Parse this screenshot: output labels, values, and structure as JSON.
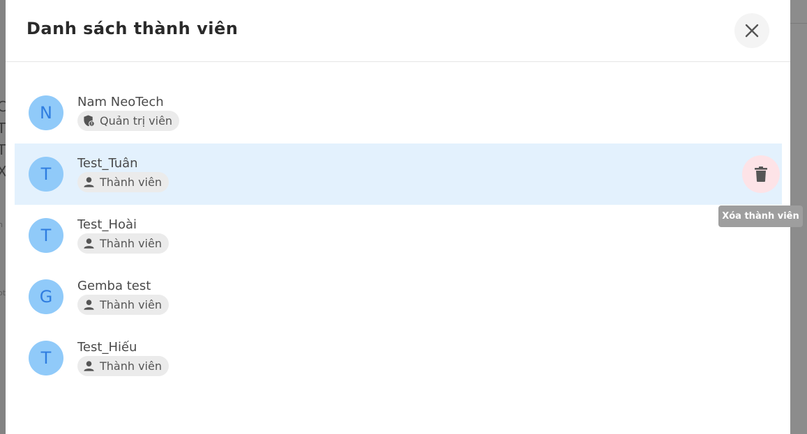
{
  "background": {
    "chars": [
      "C",
      "T",
      "T",
      "X"
    ],
    "fragments": [
      "n",
      "ot"
    ]
  },
  "dialog": {
    "title": "Danh sách thành viên",
    "close_icon": "close-icon"
  },
  "members": [
    {
      "initial": "N",
      "name": "Nam NeoTech",
      "role": "Quản trị viên",
      "role_icon": "admin-shield-icon",
      "highlighted": false
    },
    {
      "initial": "T",
      "name": "Test_Tuân",
      "role": "Thành viên",
      "role_icon": "person-icon",
      "highlighted": true
    },
    {
      "initial": "T",
      "name": "Test_Hoài",
      "role": "Thành viên",
      "role_icon": "person-icon",
      "highlighted": false
    },
    {
      "initial": "G",
      "name": "Gemba test",
      "role": "Thành viên",
      "role_icon": "person-icon",
      "highlighted": false
    },
    {
      "initial": "T",
      "name": "Test_Hiếu",
      "role": "Thành viên",
      "role_icon": "person-icon",
      "highlighted": false
    }
  ],
  "delete_action": {
    "icon": "trash-icon",
    "tooltip": "Xóa thành viên"
  },
  "colors": {
    "avatar_bg": "#90caf9",
    "avatar_text": "#2f7de0",
    "highlight_row": "#e3f1fd",
    "delete_bg": "#fde3e7",
    "tooltip_bg": "#9e9e9e"
  }
}
